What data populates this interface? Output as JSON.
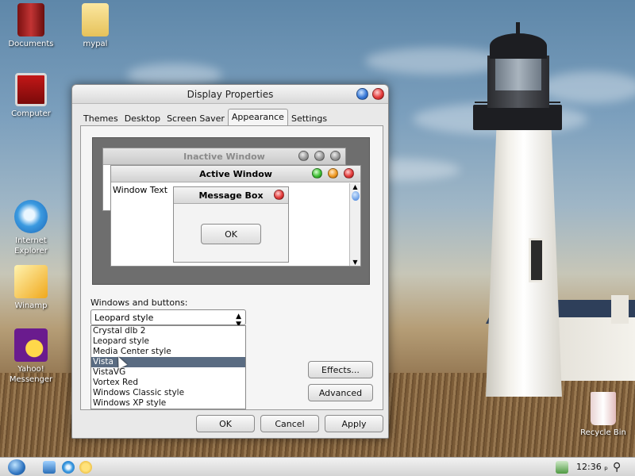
{
  "desktop": {
    "icons": [
      {
        "label": "Documents"
      },
      {
        "label": "mypal"
      },
      {
        "label": "Computer"
      },
      {
        "label": "Internet\nExplorer"
      },
      {
        "label": "Winamp"
      },
      {
        "label": "Yahoo!\nMessenger"
      },
      {
        "label": "Recycle Bin"
      }
    ]
  },
  "dialog": {
    "title": "Display Properties",
    "tabs": [
      "Themes",
      "Desktop",
      "Screen Saver",
      "Appearance",
      "Settings"
    ],
    "active_tab": "Appearance",
    "preview": {
      "inactive_title": "Inactive Window",
      "active_title": "Active Window",
      "window_text": "Window Text",
      "message_title": "Message Box",
      "ok_label": "OK"
    },
    "windows_buttons_label": "Windows and buttons:",
    "windows_buttons_value": "Leopard style",
    "style_options": [
      "Crystal dlb 2",
      "Leopard style",
      "Media Center style",
      "Vista",
      "VistaVG",
      "Vortex Red",
      "Windows Classic style",
      "Windows XP style"
    ],
    "selected_option": "Vista",
    "effects_label": "Effects...",
    "advanced_label": "Advanced",
    "ok_label": "OK",
    "cancel_label": "Cancel",
    "apply_label": "Apply"
  },
  "taskbar": {
    "clock": "12:36 ₚ"
  }
}
